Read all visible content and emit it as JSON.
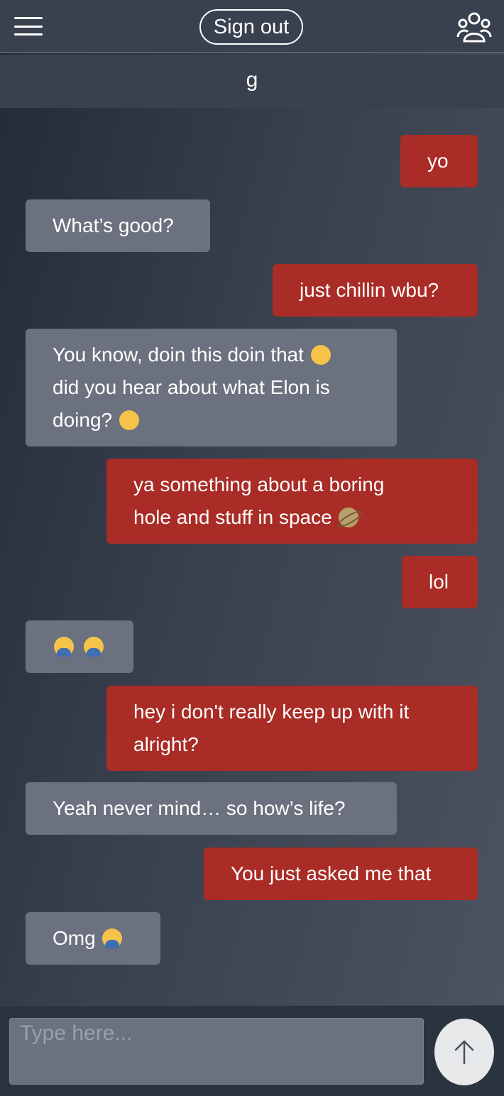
{
  "header": {
    "sign_out_label": "Sign out",
    "menu_icon": "hamburger-menu-icon",
    "users_icon": "people-group-icon"
  },
  "room": {
    "title": "g"
  },
  "messages": [
    {
      "direction": "sent",
      "text": "yo"
    },
    {
      "direction": "received",
      "text": "What’s good?"
    },
    {
      "direction": "sent",
      "text": "just chillin wbu?"
    },
    {
      "direction": "received",
      "lines": [
        "You know, doin this doin that",
        "did you hear about what Elon is",
        "doing?"
      ]
    },
    {
      "direction": "sent",
      "lines": [
        "ya something about a boring",
        "hole and stuff in space"
      ]
    },
    {
      "direction": "sent",
      "text": "lol"
    },
    {
      "direction": "received",
      "text": ""
    },
    {
      "direction": "sent",
      "lines": [
        "hey i don't really keep up with it",
        "alright?"
      ]
    },
    {
      "direction": "received",
      "text": "Yeah never mind… so how’s life?"
    },
    {
      "direction": "sent",
      "text": "You just asked me that"
    },
    {
      "direction": "received",
      "text": "Omg"
    }
  ],
  "composer": {
    "placeholder": "Type here...",
    "send_icon": "arrow-up-icon"
  },
  "colors": {
    "sent_bubble": "#a92c26",
    "received_bubble": "#6b717e",
    "header_bg": "#3a414e"
  }
}
